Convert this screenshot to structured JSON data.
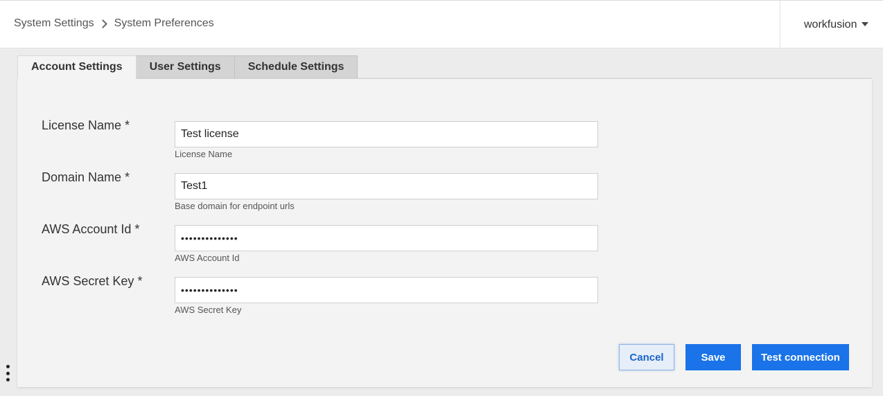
{
  "breadcrumb": {
    "parent": "System Settings",
    "current": "System Preferences"
  },
  "user_menu": {
    "label": "workfusion"
  },
  "tabs": [
    {
      "label": "Account Settings",
      "active": true
    },
    {
      "label": "User Settings",
      "active": false
    },
    {
      "label": "Schedule Settings",
      "active": false
    }
  ],
  "form": {
    "fields": [
      {
        "label": "License Name *",
        "value": "Test license",
        "hint": "License Name",
        "type": "text"
      },
      {
        "label": "Domain Name *",
        "value": "Test1",
        "hint": "Base domain for endpoint urls",
        "type": "text"
      },
      {
        "label": "AWS Account Id *",
        "value": "••••••••••••••",
        "hint": "AWS Account Id",
        "type": "password"
      },
      {
        "label": "AWS Secret Key *",
        "value": "••••••••••••••",
        "hint": "AWS Secret Key",
        "type": "password"
      }
    ]
  },
  "buttons": {
    "cancel": "Cancel",
    "save": "Save",
    "test_connection": "Test connection"
  },
  "colors": {
    "primary": "#1a73e8",
    "panel_bg": "#f3f3f3",
    "page_bg": "#ececec"
  },
  "icons": {
    "breadcrumb_separator": "chevron-right-icon",
    "user_caret": "caret-down-icon",
    "more_menu": "kebab-menu-icon"
  }
}
